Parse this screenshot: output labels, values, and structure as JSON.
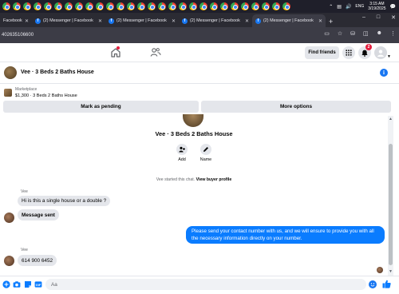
{
  "system_tray": {
    "language": "ENG",
    "time": "3:15 AM",
    "date": "3/19/2025"
  },
  "tabs": [
    {
      "label": "Facebook",
      "active": false
    },
    {
      "label": "(2) Messenger | Facebook",
      "active": false
    },
    {
      "label": "(2) Messenger | Facebook",
      "active": false
    },
    {
      "label": "(2) Messenger | Facebook",
      "active": false
    },
    {
      "label": "(2) Messenger | Facebook",
      "active": true
    }
  ],
  "address_bar": {
    "url": "402635106600"
  },
  "fb_nav": {
    "find_friends_label": "Find friends",
    "notification_count": "2"
  },
  "conversation": {
    "title": "Vee · 3 Beds 2 Baths House"
  },
  "listing": {
    "kicker": "Marketplace",
    "price_title": "$1,300 · 3 Beds 2 Baths House",
    "mark_pending_label": "Mark as pending",
    "more_options_label": "More options"
  },
  "chat_intro": {
    "title": "Vee · 3 Beds 2 Baths House",
    "add_label": "Add",
    "name_label": "Name",
    "started_prefix": "Vee started this chat.",
    "view_profile_link": "View buyer profile"
  },
  "messages": {
    "group1_sender": "Vee",
    "msg1": "Hi is this a single house or a double ?",
    "msg2": "Message sent",
    "outgoing": "Please send your contact number with us, and we will ensure to provide you with all the necessary information directly on your number.",
    "group2_sender": "Vee",
    "msg3": "614 900 6452"
  },
  "composer": {
    "placeholder": "Aa"
  },
  "colors": {
    "messenger_blue": "#0a7cff",
    "fb_blue": "#1877f2",
    "incoming_bubble": "#e4e6eb",
    "badge_red": "#e41e3f"
  }
}
